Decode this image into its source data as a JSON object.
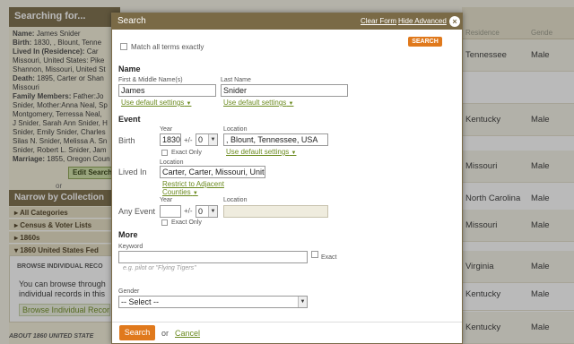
{
  "left_panel": {
    "header": "Searching for...",
    "name_label": "Name:",
    "name_value": "James Snider",
    "birth_label": "Birth:",
    "birth_value": "1830, , Blount, Tenne",
    "lived_label": "Lived In (Residence):",
    "lived_value1": "Car",
    "lived_value2": "Missouri, United States: Pike",
    "lived_value3": "Shannon, Missouri, United St",
    "death_label": "Death:",
    "death_value": "1895, Carter or Shan",
    "death_value2": "Missouri",
    "family_label": "Family Members:",
    "family_value1": "Father:Jo",
    "family_value2": "Snider, Mother:Anna Neal, Sp",
    "family_value3": "Montgomery, Terressa Neal,",
    "family_value4": "J Snider, Sarah Ann Snider, H",
    "family_value5": "Snider, Emily Snider, Charles",
    "family_value6": "Silas N. Snider, Melissa A. Sn",
    "family_value7": "Snider, Robert L. Snider, Jam",
    "marriage_label": "Marriage:",
    "marriage_value": "1855, Oregon Coun",
    "edit_button": "Edit Search",
    "or_text": "or",
    "narrow_header": "Narrow by Collection",
    "categories": [
      "All Categories",
      "Census & Voter Lists",
      "1860s",
      "1860 United States Fed"
    ],
    "browse_title": "BROWSE INDIVIDUAL RECO",
    "browse_text1": "You can browse through",
    "browse_text2": "individual records in this",
    "browse_link": "Browse Individual Recor",
    "about_text": "ABOUT 1860 UNITED STATE"
  },
  "results": {
    "header_place": "Residence",
    "header_gender": "Gende",
    "rows": [
      {
        "place": "Tennessee",
        "gender": "Male"
      },
      {
        "place": "",
        "gender": ""
      },
      {
        "place": "Kentucky",
        "gender": "Male"
      },
      {
        "place": "",
        "gender": ""
      },
      {
        "place": "Missouri",
        "gender": "Male"
      },
      {
        "place": "North Carolina",
        "gender": "Male"
      },
      {
        "place": "Missouri",
        "gender": "Male"
      },
      {
        "place": "",
        "gender": ""
      },
      {
        "place": "Virginia",
        "gender": "Male"
      },
      {
        "place": "Kentucky",
        "gender": "Male"
      },
      {
        "place": "Kentucky",
        "gender": "Male"
      }
    ]
  },
  "modal": {
    "title": "Search",
    "clear_form": "Clear Form",
    "hide_advanced": "Hide Advanced",
    "close": "×",
    "search_small": "SEARCH",
    "match_all": "Match all terms exactly",
    "name_section": "Name",
    "first_label": "First & Middle Name(s)",
    "first_value": "James",
    "last_label": "Last Name",
    "last_value": "Snider",
    "default_settings": "Use default settings",
    "event_section": "Event",
    "year_label": "Year",
    "location_label": "Location",
    "birth_label": "Birth",
    "birth_year": "1830",
    "plusminus": "+/-",
    "birth_range": "0",
    "birth_location": ", Blount, Tennessee, USA",
    "exact_only": "Exact Only",
    "lived_label": "Lived In",
    "lived_location": "Carter, Carter, Missouri, Unite",
    "restrict_adjacent": "Restrict to Adjacent",
    "counties": "Counties",
    "any_event_label": "Any Event",
    "any_year": "",
    "any_range": "0",
    "any_location": "",
    "more_section": "More",
    "keyword_label": "Keyword",
    "keyword_value": "",
    "keyword_exact": "Exact",
    "keyword_hint": "e.g. pilot or \"Flying Tigers\"",
    "gender_label": "Gender",
    "gender_value": "-- Select --",
    "search_button": "Search",
    "or_text": "or",
    "cancel": "Cancel"
  }
}
